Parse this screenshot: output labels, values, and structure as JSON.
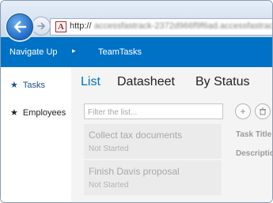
{
  "browser": {
    "address_prefix": "http://",
    "address_rest": "accessfastrack-2372d966f9f6ad.accessfastrack.ap",
    "favicon_letter": "A",
    "back_icon": "arrow-left-icon",
    "forward_icon": "arrow-right-icon"
  },
  "suitebar": {
    "navigate_up": "Navigate Up",
    "caret": "▸",
    "app_title": "TeamTasks",
    "color": "#0072c6"
  },
  "left_nav": {
    "items": [
      {
        "label": "Tasks",
        "icon": "star-icon",
        "active": true
      },
      {
        "label": "Employees",
        "icon": "star-icon",
        "active": false
      }
    ]
  },
  "views": {
    "tabs": [
      "List",
      "Datasheet",
      "By Status"
    ],
    "active": "List"
  },
  "list": {
    "filter_placeholder": "Filter the list...",
    "items": [
      {
        "title": "Collect tax documents",
        "status": "Not Started"
      },
      {
        "title": "Finish Davis proposal",
        "status": "Not Started"
      }
    ]
  },
  "detail": {
    "add_icon": "plus-icon",
    "delete_icon": "trash-icon",
    "fields": [
      "Task Title",
      "Description"
    ]
  }
}
